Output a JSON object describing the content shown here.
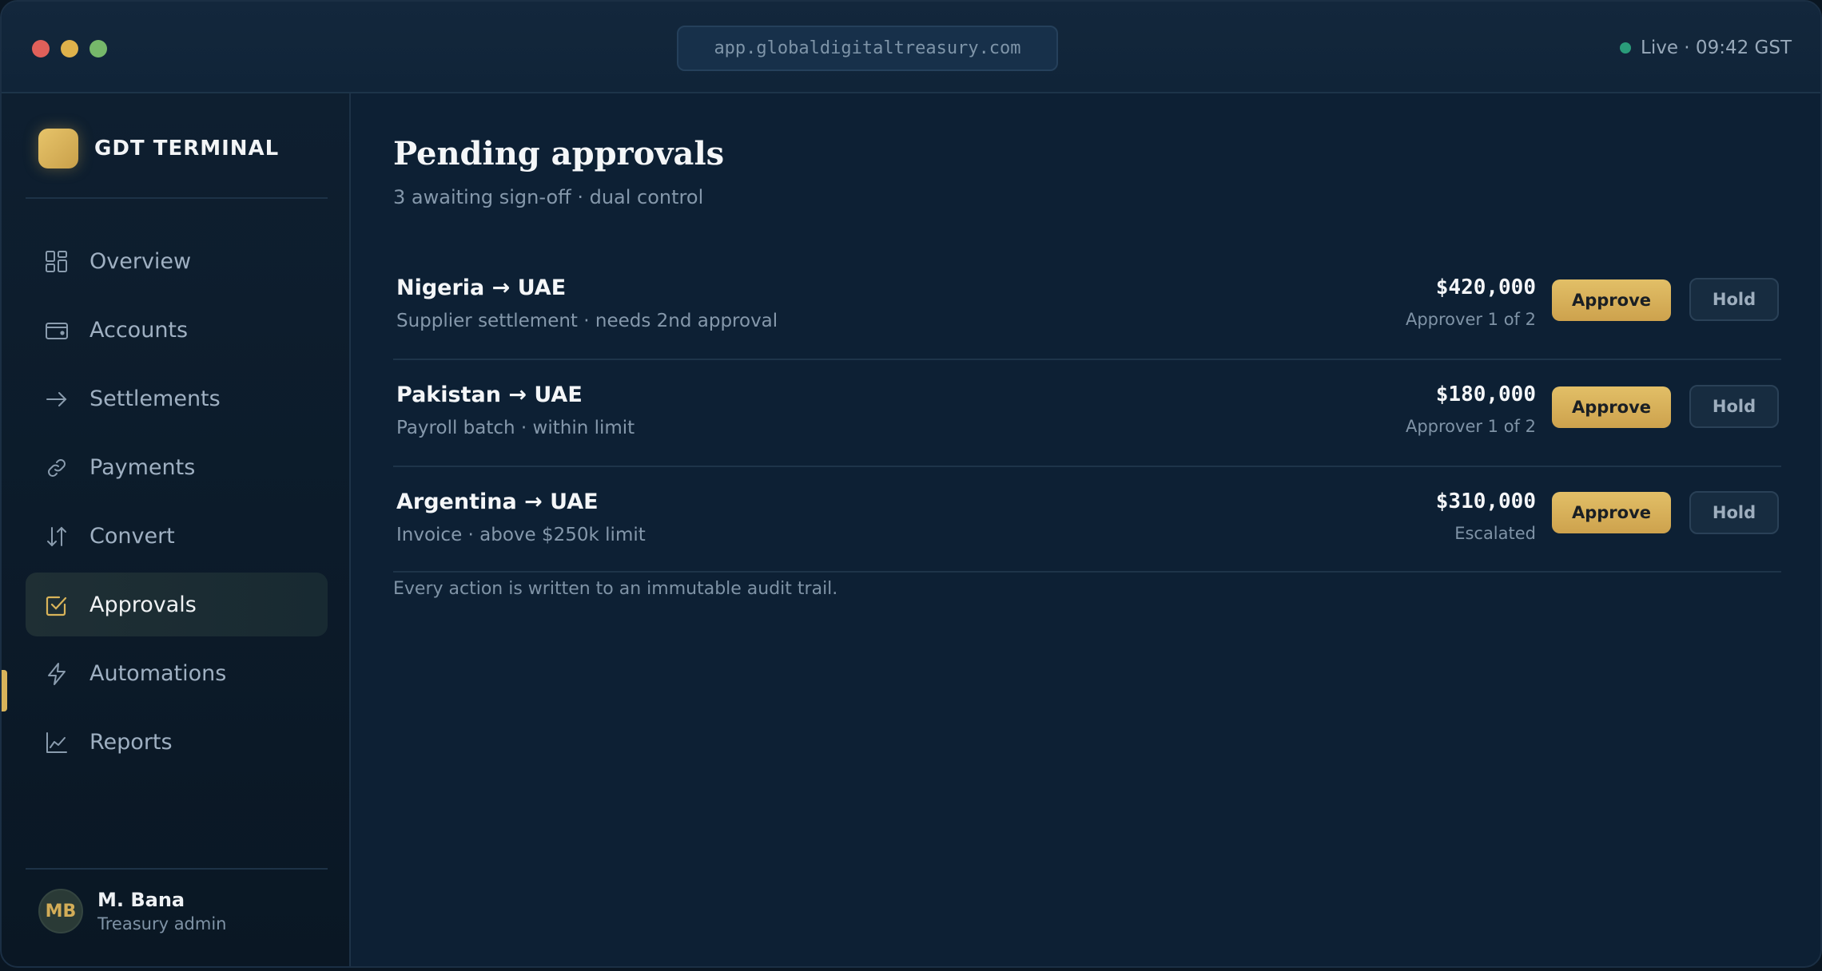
{
  "window": {
    "url": "app.globaldigitaltreasury.com",
    "live_status": "Live · 09:42 GST"
  },
  "brand": {
    "name": "GDT TERMINAL"
  },
  "sidebar": {
    "items": [
      {
        "label": "Overview",
        "icon": "grid-icon"
      },
      {
        "label": "Accounts",
        "icon": "wallet-icon"
      },
      {
        "label": "Settlements",
        "icon": "arrow-right-icon"
      },
      {
        "label": "Payments",
        "icon": "link-icon"
      },
      {
        "label": "Convert",
        "icon": "swap-arrows-icon"
      },
      {
        "label": "Approvals",
        "icon": "checkbox-icon",
        "active": true
      },
      {
        "label": "Automations",
        "icon": "bolt-icon"
      },
      {
        "label": "Reports",
        "icon": "line-chart-icon"
      }
    ]
  },
  "user": {
    "initials": "MB",
    "name": "M. Bana",
    "role": "Treasury admin"
  },
  "main": {
    "title": "Pending approvals",
    "subtitle": "3 awaiting sign-off · dual control",
    "approvals": [
      {
        "title": "Nigeria → UAE",
        "description": "Supplier settlement · needs 2nd approval",
        "amount": "$420,000",
        "status": "Approver 1 of 2",
        "approve_label": "Approve",
        "hold_label": "Hold"
      },
      {
        "title": "Pakistan → UAE",
        "description": "Payroll batch · within limit",
        "amount": "$180,000",
        "status": "Approver 1 of 2",
        "approve_label": "Approve",
        "hold_label": "Hold"
      },
      {
        "title": "Argentina → UAE",
        "description": "Invoice · above $250k limit",
        "amount": "$310,000",
        "status": "Escalated",
        "approve_label": "Approve",
        "hold_label": "Hold"
      }
    ],
    "footnote": "Every action is written to an immutable audit trail."
  },
  "colors": {
    "accent": "#d9b45a",
    "background": "#0d2034",
    "sidebar": "#0c1b2a",
    "live_dot": "#2a9c7a"
  }
}
